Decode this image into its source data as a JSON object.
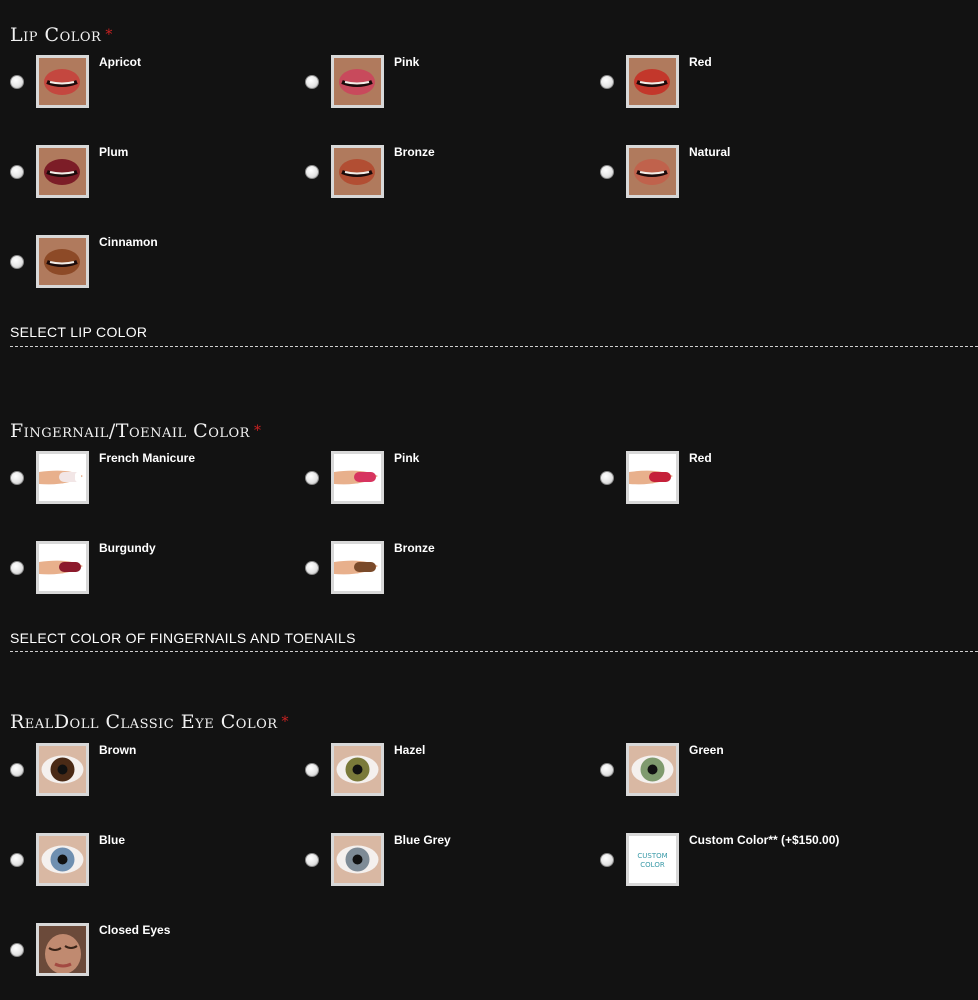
{
  "lip_color": {
    "title": "Lip Color",
    "required_mark": "*",
    "options": [
      {
        "label": "Apricot",
        "icon": "lips-apricot-icon",
        "color": "#c4473f"
      },
      {
        "label": "Pink",
        "icon": "lips-pink-icon",
        "color": "#c84a5c"
      },
      {
        "label": "Red",
        "icon": "lips-red-icon",
        "color": "#c3372b"
      },
      {
        "label": "Plum",
        "icon": "lips-plum-icon",
        "color": "#7c1d27"
      },
      {
        "label": "Bronze",
        "icon": "lips-bronze-icon",
        "color": "#b24e33"
      },
      {
        "label": "Natural",
        "icon": "lips-natural-icon",
        "color": "#c0624c"
      },
      {
        "label": "Cinnamon",
        "icon": "lips-cinnamon-icon",
        "color": "#8d4a27"
      }
    ],
    "hint": "SELECT LIP COLOR"
  },
  "nail_color": {
    "title": "Fingernail/Toenail Color",
    "required_mark": "*",
    "options": [
      {
        "label": "French Manicure",
        "icon": "nail-french-manicure-icon",
        "color": "#f2e6e6"
      },
      {
        "label": "Pink",
        "icon": "nail-pink-icon",
        "color": "#d7345f"
      },
      {
        "label": "Red",
        "icon": "nail-red-icon",
        "color": "#c5213a"
      },
      {
        "label": "Burgundy",
        "icon": "nail-burgundy-icon",
        "color": "#8c1a2c"
      },
      {
        "label": "Bronze",
        "icon": "nail-bronze-icon",
        "color": "#7a4a2a"
      }
    ],
    "hint": "SELECT COLOR OF FINGERNAILS AND TOENAILS"
  },
  "eye_color": {
    "title": "RealDoll Classic Eye Color",
    "required_mark": "*",
    "options": [
      {
        "label": "Brown",
        "icon": "eye-brown-icon",
        "color": "#4a2a16"
      },
      {
        "label": "Hazel",
        "icon": "eye-hazel-icon",
        "color": "#7a7a3a"
      },
      {
        "label": "Green",
        "icon": "eye-green-icon",
        "color": "#7f9a6e"
      },
      {
        "label": "Blue",
        "icon": "eye-blue-icon",
        "color": "#6f8fb0"
      },
      {
        "label": "Blue Grey",
        "icon": "eye-blue-grey-icon",
        "color": "#7e8b96"
      },
      {
        "label": "Custom Color** (+$150.00)",
        "icon": "custom-color-icon",
        "color": "#3a9aa8",
        "thumb_text": "CUSTOM COLOR"
      },
      {
        "label": "Closed Eyes",
        "icon": "closed-eyes-icon",
        "color": "#c08a70"
      }
    ]
  }
}
